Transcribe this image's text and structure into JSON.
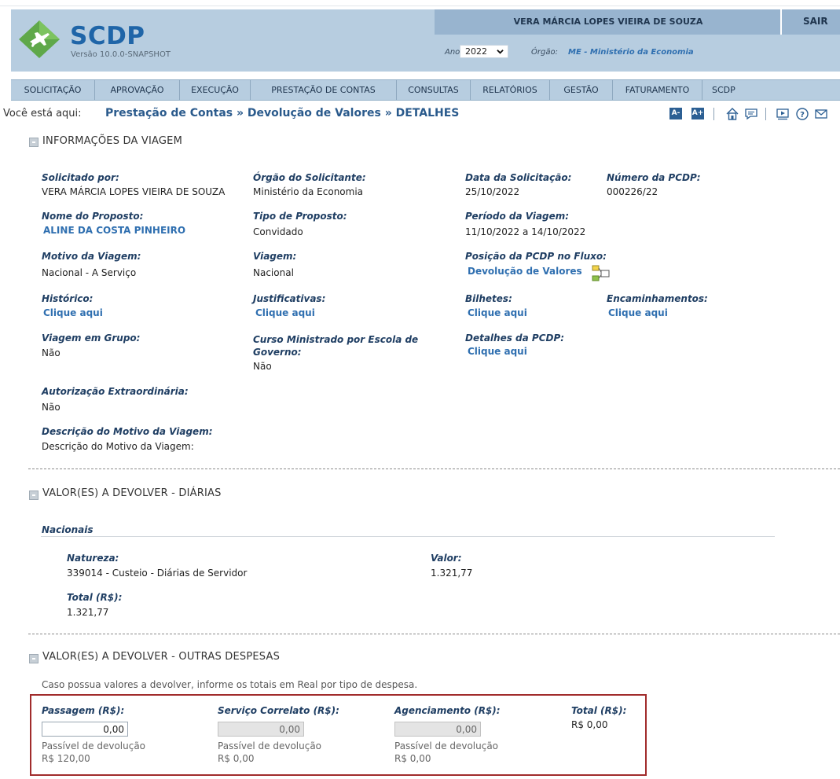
{
  "header": {
    "app_name": "SCDP",
    "version": "Versão 10.0.0-SNAPSHOT",
    "user_name": "VERA MÁRCIA LOPES VIEIRA DE SOUZA",
    "logout_label": "SAIR",
    "year_label": "Ano:",
    "year_value": "2022",
    "org_label": "Órgão:",
    "org_value": "ME - Ministério da Economia",
    "colors": {
      "bar": "#b7cde0",
      "accent": "#1f65a8",
      "logo_green": "#5fa84a"
    }
  },
  "menu": {
    "items": [
      "SOLICITAÇÃO",
      "APROVAÇÃO",
      "EXECUÇÃO",
      "PRESTAÇÃO DE CONTAS",
      "CONSULTAS",
      "RELATÓRIOS",
      "GESTÃO",
      "FATURAMENTO",
      "SCDP"
    ]
  },
  "breadcrumb": {
    "prefix": "Você está aqui:",
    "items": [
      "Prestação de Contas",
      "Devolução de Valores",
      "DETALHES"
    ],
    "separator": "»",
    "font_small": "A-",
    "font_large": "A+"
  },
  "toolbar_icons": [
    "home-icon",
    "chat-icon",
    "presentation-icon",
    "help-icon",
    "mail-icon"
  ],
  "viagem": {
    "title": "INFORMAÇÕES DA VIAGEM",
    "solicitado_por_label": "Solicitado por:",
    "solicitado_por": "VERA MÁRCIA LOPES VIEIRA DE SOUZA",
    "orgao_solicitante_label": "Órgão do Solicitante:",
    "orgao_solicitante": "Ministério da Economia",
    "data_solicitacao_label": "Data da Solicitação:",
    "data_solicitacao": "25/10/2022",
    "numero_pcdp_label": "Número da PCDP:",
    "numero_pcdp": "000226/22",
    "nome_proposto_label": "Nome do Proposto:",
    "nome_proposto": "ALINE DA COSTA PINHEIRO",
    "tipo_proposto_label": "Tipo de Proposto:",
    "tipo_proposto": "Convidado",
    "periodo_label": "Período da Viagem:",
    "periodo": "11/10/2022 a 14/10/2022",
    "motivo_label": "Motivo da Viagem:",
    "motivo": "Nacional - A Serviço",
    "viagem_label": "Viagem:",
    "viagem": "Nacional",
    "posicao_label": "Posição da PCDP no Fluxo:",
    "posicao": "Devolução de Valores",
    "historico_label": "Histórico:",
    "justificativas_label": "Justificativas:",
    "bilhetes_label": "Bilhetes:",
    "encaminhamentos_label": "Encaminhamentos:",
    "link_text": "Clique aqui",
    "grupo_label": "Viagem em Grupo:",
    "grupo": "Não",
    "curso_label_1": "Curso Ministrado por Escola de",
    "curso_label_2": "Governo:",
    "curso": "Não",
    "detalhes_label": "Detalhes da PCDP:",
    "autorizacao_label": "Autorização Extraordinária:",
    "autorizacao": "Não",
    "descricao_label": "Descrição do Motivo da Viagem:",
    "descricao": "Descrição do Motivo da Viagem:"
  },
  "diarias": {
    "title": "VALOR(ES) A DEVOLVER - DIÁRIAS",
    "subhead": "Nacionais",
    "natureza_label": "Natureza:",
    "natureza": "339014 - Custeio - Diárias de Servidor",
    "valor_label": "Valor:",
    "valor": "1.321,77",
    "total_label": "Total (R$):",
    "total": "1.321,77"
  },
  "outras": {
    "title": "VALOR(ES) A DEVOLVER - OUTRAS DESPESAS",
    "instruction": "Caso possua valores a devolver, informe os totais em Real por tipo de despesa.",
    "passagem_label": "Passagem (R$):",
    "passagem_value": "0,00",
    "passagem_hint": "Passível de devolução",
    "passagem_hint_value": "R$ 120,00",
    "servico_label": "Serviço Correlato (R$):",
    "servico_value": "0,00",
    "servico_hint": "Passível de devolução",
    "servico_hint_value": "R$ 0,00",
    "agenciamento_label": "Agenciamento (R$):",
    "agenciamento_value": "0,00",
    "agenciamento_hint": "Passível de devolução",
    "agenciamento_hint_value": "R$ 0,00",
    "total_label": "Total (R$):",
    "total_value": "R$ 0,00",
    "highlight_color": "#a12c2c"
  }
}
